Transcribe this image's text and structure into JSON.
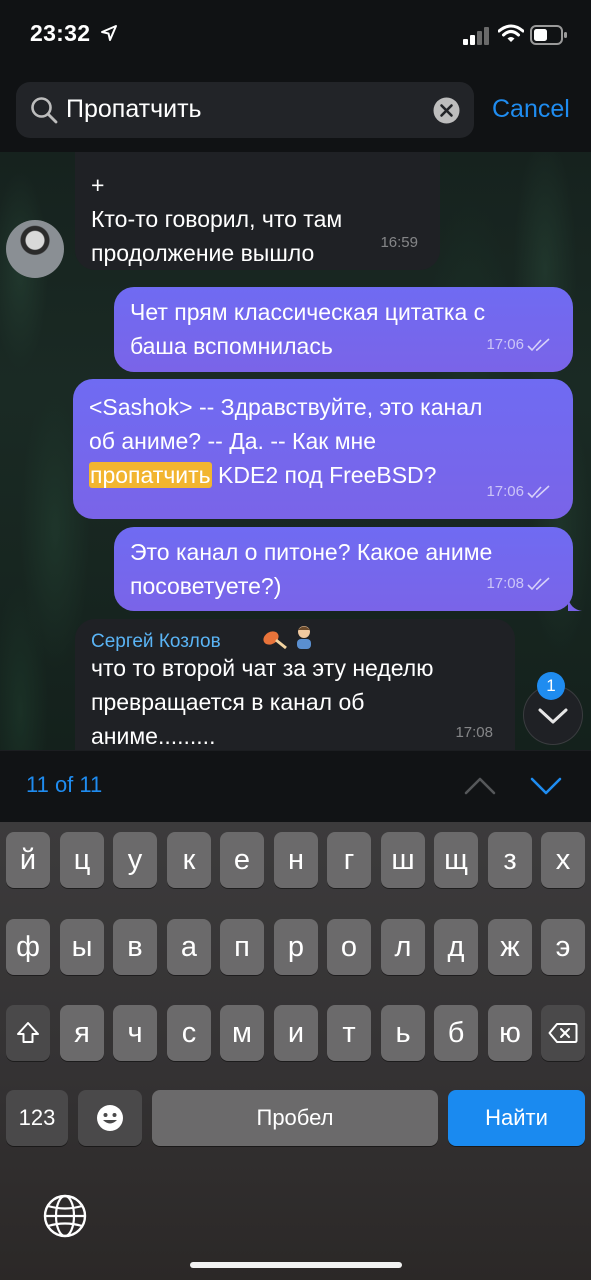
{
  "status_bar": {
    "time": "23:32"
  },
  "search": {
    "query": "Пропатчить",
    "cancel_label": "Cancel"
  },
  "messages": {
    "m1": {
      "lines": [
        "+",
        "Кто-то говорил, что там",
        "продолжение вышло"
      ],
      "time": "16:59"
    },
    "m2": {
      "lines": [
        "Чет прям классическая цитатка с",
        "баша вспомнилась"
      ],
      "time": "17:06"
    },
    "m3": {
      "line1": "<Sashok> -- Здравствуйте, это канал",
      "line2": "об аниме? -- Да. -- Как мне",
      "highlight": "пропатчить",
      "line3_rest": " KDE2 под FreeBSD?",
      "time": "17:06"
    },
    "m4": {
      "lines": [
        "Это канал о питоне? Какое аниме",
        "посоветуете?)"
      ],
      "time": "17:08"
    },
    "m5": {
      "sender": "Сергей Козлов",
      "lines": [
        "что то второй чат за эту неделю",
        "превращается в канал об",
        "аниме........."
      ],
      "time": "17:08"
    }
  },
  "unread_badge": "1",
  "search_nav": {
    "counter": "11 of 11"
  },
  "keyboard": {
    "row1": [
      "й",
      "ц",
      "у",
      "к",
      "е",
      "н",
      "г",
      "ш",
      "щ",
      "з",
      "х"
    ],
    "row2": [
      "ф",
      "ы",
      "в",
      "а",
      "п",
      "р",
      "о",
      "л",
      "д",
      "ж",
      "э"
    ],
    "row3": [
      "я",
      "ч",
      "с",
      "м",
      "и",
      "т",
      "ь",
      "б",
      "ю"
    ],
    "numbers_label": "123",
    "space_label": "Пробел",
    "go_label": "Найти"
  },
  "icons": {
    "location": "location-arrow-icon",
    "signal": "cellular-signal-icon",
    "wifi": "wifi-icon",
    "battery": "battery-icon",
    "search": "search-icon",
    "clear": "clear-icon",
    "scroll_down": "chevron-down-icon",
    "prev": "chevron-up-icon",
    "next": "chevron-down-icon",
    "shift": "shift-icon",
    "backspace": "backspace-icon",
    "emoji": "emoji-icon",
    "globe": "globe-icon"
  },
  "colors": {
    "accent": "#1f8cf0",
    "outgoing_bubble": "#7068ee",
    "highlight": "#f2b530",
    "sender_name": "#5ab4f5"
  }
}
